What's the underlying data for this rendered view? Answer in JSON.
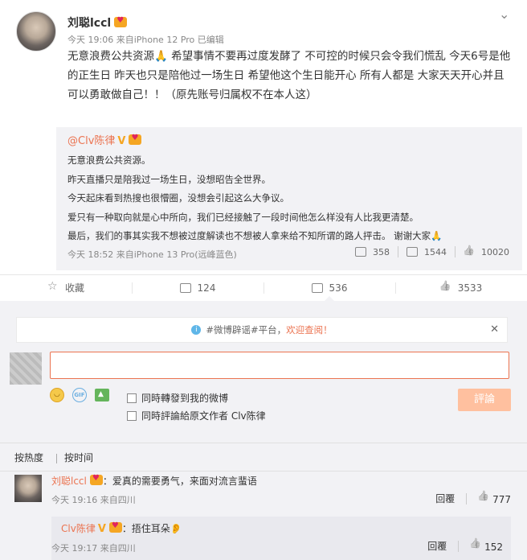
{
  "post": {
    "author": "刘聪lccl",
    "meta": "今天 19:06 来自iPhone 12 Pro  已编辑",
    "content": "无意浪费公共资源🙏 希望事情不要再过度发酵了 不可控的时候只会令我们慌乱 今天6号是他的正生日 昨天也只是陪他过一场生日 希望他这个生日能开心 所有人都是 大家天天开心并且可以勇敢做自己！！（原先账号归属权不在本人这）"
  },
  "repost": {
    "author": "@Clv陈律",
    "lines": [
      "无意浪费公共资源。",
      "昨天直播只是陪我过一场生日，没想昭告全世界。",
      "今天起床看到热搜也很懵圈，没想会引起这么大争议。",
      "爱只有一种取向就是心中所向，我们已经接触了一段时间他怎么样没有人比我更清楚。",
      "最后，我们的事其实我不想被过度解读也不想被人拿来给不知所谓的路人抨击。 谢谢大家🙏"
    ],
    "meta": "今天 18:52 来自iPhone 13 Pro(远峰蓝色)",
    "reposts": "358",
    "comments": "1544",
    "likes": "10020"
  },
  "actions": {
    "favorite": "收藏",
    "reposts": "124",
    "comments": "536",
    "likes": "3533"
  },
  "notice": {
    "tag": "#微博辟谣#平台，",
    "cta": "欢迎查阅！"
  },
  "composer": {
    "option_repost": "同時轉發到我的微博",
    "option_comment": "同時評論給原文作者 Clv陈律",
    "submit": "評論",
    "gif": "GIF"
  },
  "sort": {
    "hot": "按热度",
    "time": "按时间"
  },
  "comments": [
    {
      "author": "刘聪lccl",
      "text": "：爱真的需要勇气，来面对流言蜚语",
      "meta": "今天 19:16 来自四川",
      "reply": "回覆",
      "likes": "777"
    },
    {
      "author": "Clv陈律",
      "text": "：捂住耳朵👂",
      "meta": "今天 19:17 来自四川",
      "reply": "回覆",
      "likes": "152"
    }
  ]
}
